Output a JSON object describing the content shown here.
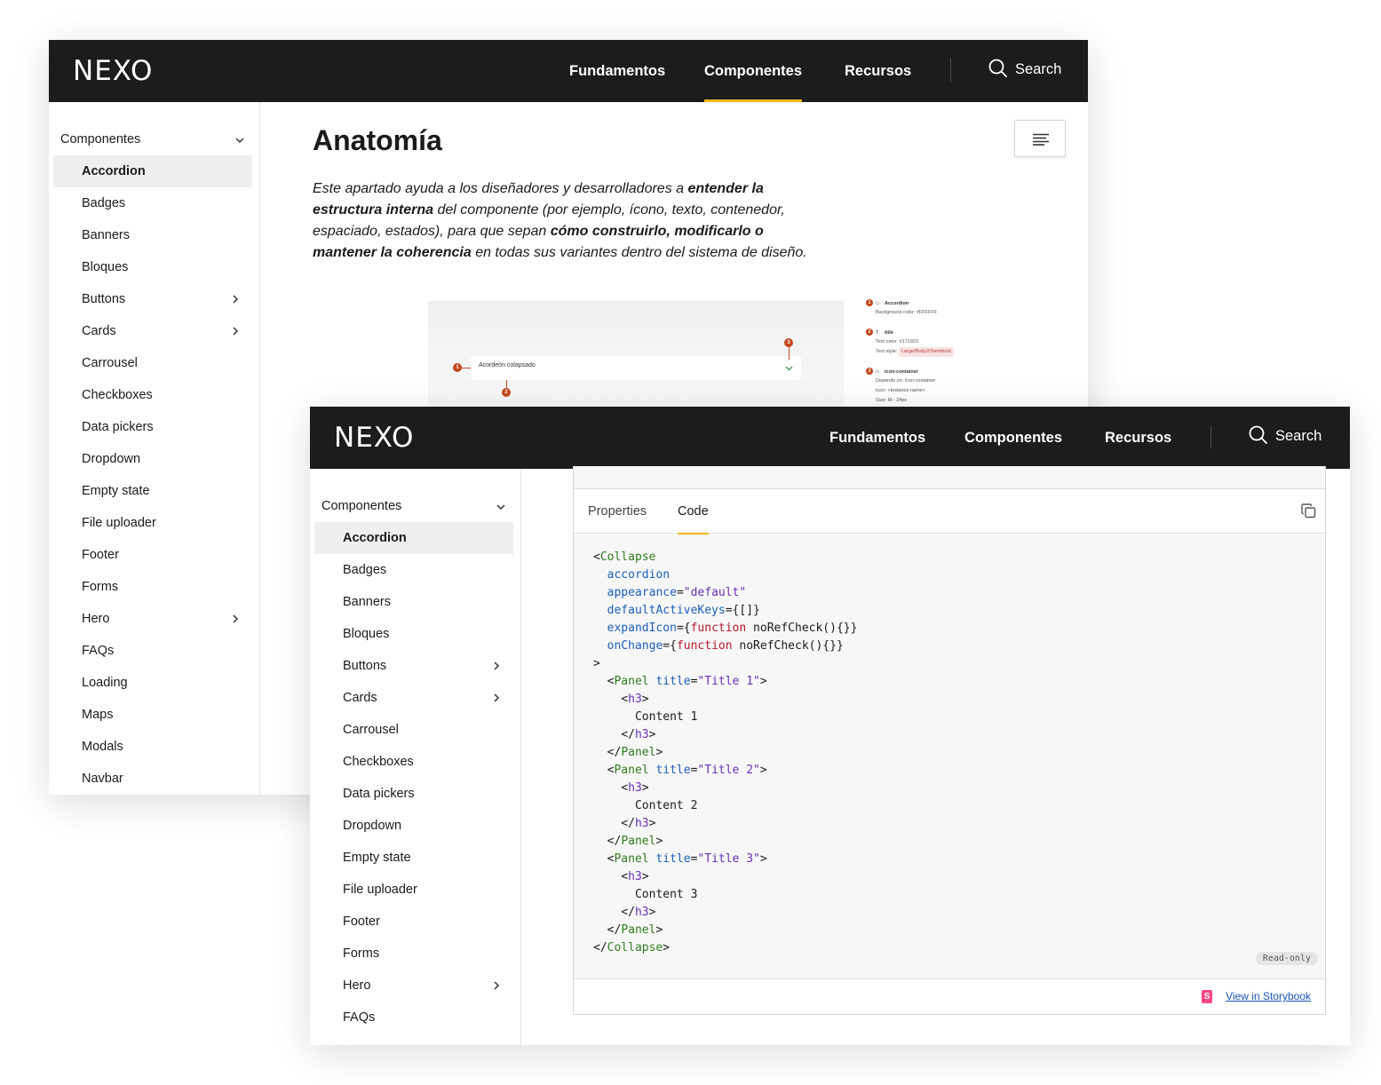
{
  "brand": {
    "logo": "NEXO",
    "accent": "#f0b70c",
    "nav_bg": "#1c1c1c"
  },
  "nav": {
    "items": [
      "Fundamentos",
      "Componentes",
      "Recursos"
    ],
    "active": "Componentes",
    "search_label": "Search"
  },
  "sidebar": {
    "section": "Componentes",
    "items_a": [
      {
        "label": "Accordion",
        "active": true
      },
      {
        "label": "Badges"
      },
      {
        "label": "Banners"
      },
      {
        "label": "Bloques"
      },
      {
        "label": "Buttons",
        "chevron": true
      },
      {
        "label": "Cards",
        "chevron": true
      },
      {
        "label": "Carrousel"
      },
      {
        "label": "Checkboxes"
      },
      {
        "label": "Data pickers"
      },
      {
        "label": "Dropdown"
      },
      {
        "label": "Empty state"
      },
      {
        "label": "File uploader"
      },
      {
        "label": "Footer"
      },
      {
        "label": "Forms"
      },
      {
        "label": "Hero",
        "chevron": true
      },
      {
        "label": "FAQs"
      },
      {
        "label": "Loading"
      },
      {
        "label": "Maps"
      },
      {
        "label": "Modals"
      },
      {
        "label": "Navbar"
      }
    ],
    "items_b": [
      {
        "label": "Accordion",
        "active": true
      },
      {
        "label": "Badges"
      },
      {
        "label": "Banners"
      },
      {
        "label": "Bloques"
      },
      {
        "label": "Buttons",
        "chevron": true
      },
      {
        "label": "Cards",
        "chevron": true
      },
      {
        "label": "Carrousel"
      },
      {
        "label": "Checkboxes"
      },
      {
        "label": "Data pickers"
      },
      {
        "label": "Dropdown"
      },
      {
        "label": "Empty state"
      },
      {
        "label": "File uploader"
      },
      {
        "label": "Footer"
      },
      {
        "label": "Forms"
      },
      {
        "label": "Hero",
        "chevron": true
      },
      {
        "label": "FAQs"
      }
    ]
  },
  "anatomy": {
    "title": "Anatomía",
    "intro": [
      {
        "t": "Este apartado ayuda a los diseñadores y desarrolladores a ",
        "b": false
      },
      {
        "t": "entender la estructura interna",
        "b": true
      },
      {
        "t": " del componente (por ejemplo, ícono, texto, contenedor, espaciado, estados), para que sepan ",
        "b": false
      },
      {
        "t": "cómo construirlo, modificarlo o mantener la coherencia",
        "b": true
      },
      {
        "t": " en todas sus variantes dentro del sistema de diseño.",
        "b": false
      }
    ],
    "demo_label": "Acordeón colapsado",
    "markers": [
      "1",
      "2",
      "3"
    ],
    "legend": [
      {
        "n": "1",
        "icon": "◇",
        "name": "Accordion",
        "lines": [
          "Background color: #FFFFFF"
        ]
      },
      {
        "n": "2",
        "icon": "T",
        "name": "title",
        "lines": [
          "Text color: #171923"
        ],
        "style_label": "Text style:",
        "style_tag": "Large/Body2/Semibold"
      },
      {
        "n": "3",
        "icon": "◇",
        "name": "icon-container",
        "lines": [
          "Depends on: icon-container",
          "Icon: <Instance name>",
          "Size: M - 24px"
        ]
      }
    ]
  },
  "code_panel": {
    "tabs": [
      "Properties",
      "Code"
    ],
    "active_tab": "Code",
    "badge": "Read-only",
    "storybook_link": "View in Storybook",
    "storybook_icon": "S",
    "code_lines": [
      [
        [
          "p",
          "<"
        ],
        [
          "t",
          "Collapse"
        ]
      ],
      [
        [
          "p",
          "  "
        ],
        [
          "a",
          "accordion"
        ]
      ],
      [
        [
          "p",
          "  "
        ],
        [
          "a",
          "appearance"
        ],
        [
          "p",
          "="
        ],
        [
          "s",
          "\"default\""
        ]
      ],
      [
        [
          "p",
          "  "
        ],
        [
          "a",
          "defaultActiveKeys"
        ],
        [
          "p",
          "={[]}"
        ]
      ],
      [
        [
          "p",
          "  "
        ],
        [
          "a",
          "expandIcon"
        ],
        [
          "p",
          "={"
        ],
        [
          "k",
          "function"
        ],
        [
          "p",
          " noRefCheck(){}}"
        ]
      ],
      [
        [
          "p",
          "  "
        ],
        [
          "a",
          "onChange"
        ],
        [
          "p",
          "={"
        ],
        [
          "k",
          "function"
        ],
        [
          "p",
          " noRefCheck(){}}"
        ]
      ],
      [
        [
          "p",
          ">"
        ]
      ],
      [
        [
          "p",
          "  <"
        ],
        [
          "t",
          "Panel"
        ],
        [
          "p",
          " "
        ],
        [
          "a",
          "title"
        ],
        [
          "p",
          "="
        ],
        [
          "s",
          "\"Title 1\""
        ],
        [
          "p",
          ">"
        ]
      ],
      [
        [
          "p",
          "    <"
        ],
        [
          "s",
          "h3"
        ],
        [
          "p",
          ">"
        ]
      ],
      [
        [
          "p",
          "      Content 1"
        ]
      ],
      [
        [
          "p",
          "    </"
        ],
        [
          "s",
          "h3"
        ],
        [
          "p",
          ">"
        ]
      ],
      [
        [
          "p",
          "  </"
        ],
        [
          "t",
          "Panel"
        ],
        [
          "p",
          ">"
        ]
      ],
      [
        [
          "p",
          "  <"
        ],
        [
          "t",
          "Panel"
        ],
        [
          "p",
          " "
        ],
        [
          "a",
          "title"
        ],
        [
          "p",
          "="
        ],
        [
          "s",
          "\"Title 2\""
        ],
        [
          "p",
          ">"
        ]
      ],
      [
        [
          "p",
          "    <"
        ],
        [
          "s",
          "h3"
        ],
        [
          "p",
          ">"
        ]
      ],
      [
        [
          "p",
          "      Content 2"
        ]
      ],
      [
        [
          "p",
          "    </"
        ],
        [
          "s",
          "h3"
        ],
        [
          "p",
          ">"
        ]
      ],
      [
        [
          "p",
          "  </"
        ],
        [
          "t",
          "Panel"
        ],
        [
          "p",
          ">"
        ]
      ],
      [
        [
          "p",
          "  <"
        ],
        [
          "t",
          "Panel"
        ],
        [
          "p",
          " "
        ],
        [
          "a",
          "title"
        ],
        [
          "p",
          "="
        ],
        [
          "s",
          "\"Title 3\""
        ],
        [
          "p",
          ">"
        ]
      ],
      [
        [
          "p",
          "    <"
        ],
        [
          "s",
          "h3"
        ],
        [
          "p",
          ">"
        ]
      ],
      [
        [
          "p",
          "      Content 3"
        ]
      ],
      [
        [
          "p",
          "    </"
        ],
        [
          "s",
          "h3"
        ],
        [
          "p",
          ">"
        ]
      ],
      [
        [
          "p",
          "  </"
        ],
        [
          "t",
          "Panel"
        ],
        [
          "p",
          ">"
        ]
      ],
      [
        [
          "p",
          "</"
        ],
        [
          "t",
          "Collapse"
        ],
        [
          "p",
          ">"
        ]
      ]
    ]
  },
  "icons": [
    "search-icon",
    "chevron-down-icon",
    "chevron-right-icon",
    "table-of-contents-icon",
    "copy-icon",
    "storybook-icon"
  ]
}
